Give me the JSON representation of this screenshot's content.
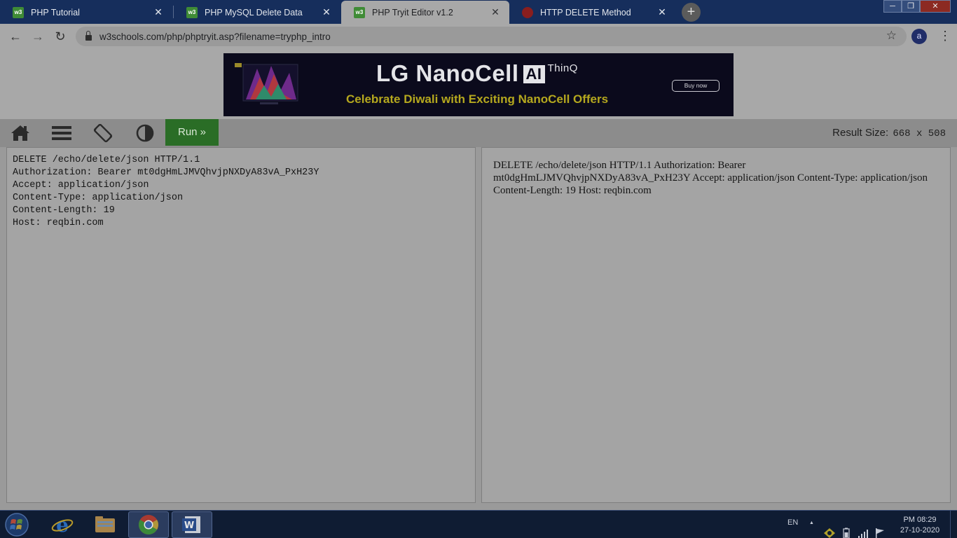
{
  "browser": {
    "tabs": [
      {
        "title": "PHP Tutorial",
        "favicon": "w3schools-icon",
        "favicon_text": "w3",
        "active": false
      },
      {
        "title": "PHP MySQL Delete Data",
        "favicon": "w3schools-icon",
        "favicon_text": "w3",
        "active": false
      },
      {
        "title": "PHP Tryit Editor v1.2",
        "favicon": "w3schools-icon",
        "favicon_text": "w3",
        "active": true
      },
      {
        "title": "HTTP DELETE Method",
        "favicon": "reqbin-icon",
        "favicon_text": "",
        "active": false
      }
    ],
    "tab_close_glyph": "✕",
    "new_tab_glyph": "+",
    "window_controls": {
      "minimize": "─",
      "maximize": "❐",
      "close": "✕"
    },
    "nav": {
      "back": "←",
      "forward": "→",
      "reload": "↻"
    },
    "address": "w3schools.com/php/phptryit.asp?filename=tryphp_intro",
    "bookmark_glyph": "☆",
    "profile_initial": "a",
    "menu_glyph": "⋮"
  },
  "ad": {
    "brand": "LG NanoCell",
    "ai_badge": "AI",
    "thinq": "ThinQ",
    "tagline": "Celebrate Diwali with Exciting NanoCell Offers",
    "cta": "Buy now"
  },
  "editor": {
    "run_label": "Run »",
    "result_size_label": "Result Size:",
    "result_size_value": "668 x 508",
    "code_lines": [
      "DELETE /echo/delete/json HTTP/1.1",
      "Authorization: Bearer mt0dgHmLJMVQhvjpNXDyA83vA_PxH23Y",
      "Accept: application/json",
      "Content-Type: application/json",
      "Content-Length: 19",
      "Host: reqbin.com"
    ],
    "result_text": "DELETE /echo/delete/json HTTP/1.1 Authorization: Bearer mt0dgHmLJMVQhvjpNXDyA83vA_PxH23Y Accept: application/json Content-Type: application/json Content-Length: 19 Host: reqbin.com"
  },
  "taskbar": {
    "language": "EN",
    "tray_up_glyph": "▲",
    "time": "PM 08:29",
    "date": "27-10-2020"
  },
  "colors": {
    "tabstrip": "#162e5c",
    "run_button": "#2a6d26",
    "ad_tagline": "#b5a81e",
    "taskbar": "#0f1c33"
  }
}
